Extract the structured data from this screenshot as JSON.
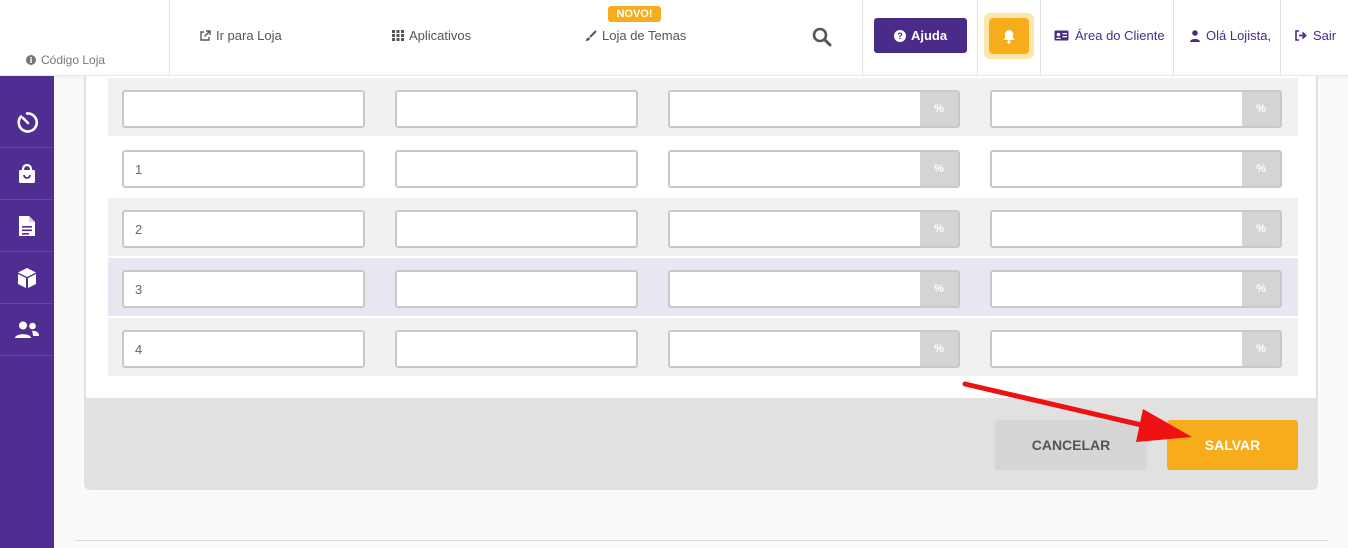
{
  "header": {
    "store_code_label": "Código Loja",
    "nav": {
      "go_to_store": "Ir para Loja",
      "apps": "Aplicativos",
      "theme_store": "Loja de Temas",
      "new_badge": "NOVO!"
    },
    "help_label": "Ajuda",
    "client_area": "Área do Cliente",
    "greeting": "Olá Lojista,",
    "logout": "Sair"
  },
  "sidebar": {
    "items": [
      {
        "icon": "dashboard-icon"
      },
      {
        "icon": "shopping-bag-icon"
      },
      {
        "icon": "document-icon"
      },
      {
        "icon": "box-icon"
      },
      {
        "icon": "users-icon"
      }
    ]
  },
  "table": {
    "percent_symbol": "%",
    "rows": [
      {
        "value": ""
      },
      {
        "value": "1"
      },
      {
        "value": "2"
      },
      {
        "value": "3"
      },
      {
        "value": "4"
      }
    ]
  },
  "actions": {
    "cancel_label": "CANCELAR",
    "save_label": "SALVAR"
  },
  "colors": {
    "brand_purple": "#4f2d91",
    "accent_orange": "#f7ac1b",
    "annotation_arrow": "#ee1111"
  }
}
